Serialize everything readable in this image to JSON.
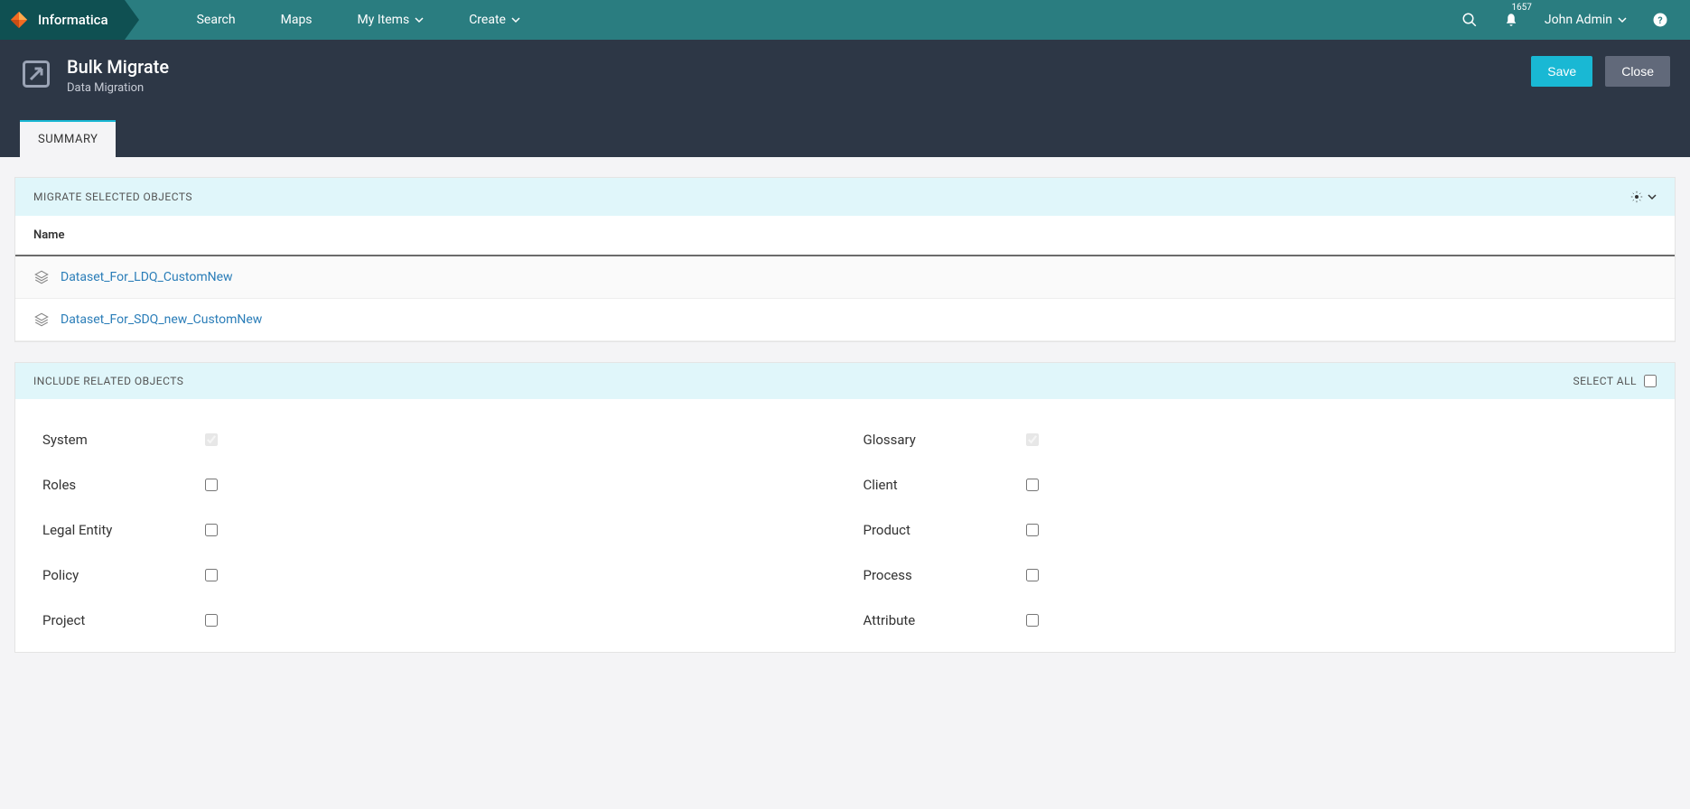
{
  "brand": "Informatica",
  "nav": {
    "items": [
      "Search",
      "Maps",
      "My Items",
      "Create"
    ],
    "dropdown": [
      false,
      false,
      true,
      true
    ],
    "badge": "1657",
    "user": "John Admin"
  },
  "page": {
    "title": "Bulk Migrate",
    "subtitle": "Data Migration",
    "tab": "SUMMARY",
    "save": "Save",
    "close": "Close"
  },
  "objects": {
    "header": "Migrate Selected Objects",
    "col": "Name",
    "rows": [
      "Dataset_For_LDQ_CustomNew",
      "Dataset_For_SDQ_new_CustomNew"
    ]
  },
  "related": {
    "header": "Include Related Objects",
    "select_all": "Select All",
    "left": [
      {
        "label": "System",
        "checked": true,
        "disabled": true
      },
      {
        "label": "Roles",
        "checked": false,
        "disabled": false
      },
      {
        "label": "Legal Entity",
        "checked": false,
        "disabled": false
      },
      {
        "label": "Policy",
        "checked": false,
        "disabled": false
      },
      {
        "label": "Project",
        "checked": false,
        "disabled": false
      }
    ],
    "right": [
      {
        "label": "Glossary",
        "checked": true,
        "disabled": true
      },
      {
        "label": "Client",
        "checked": false,
        "disabled": false
      },
      {
        "label": "Product",
        "checked": false,
        "disabled": false
      },
      {
        "label": "Process",
        "checked": false,
        "disabled": false
      },
      {
        "label": "Attribute",
        "checked": false,
        "disabled": false
      }
    ]
  }
}
